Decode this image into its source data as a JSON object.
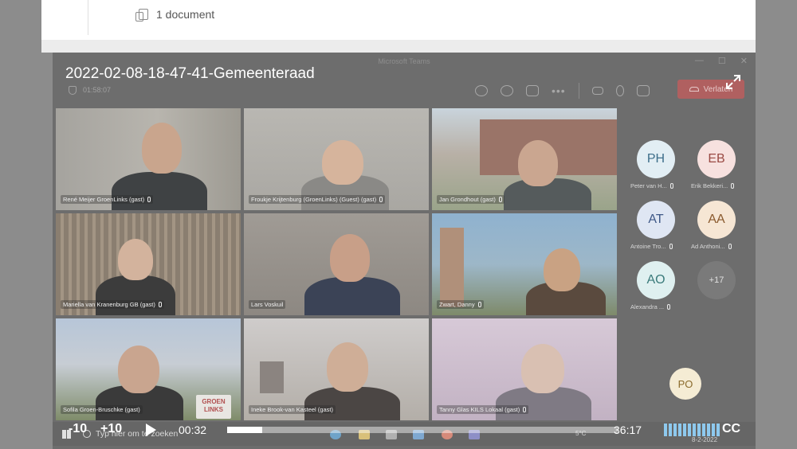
{
  "doc": {
    "count_label": "1 document"
  },
  "window": {
    "app_title": "Microsoft Teams",
    "controls": [
      "—",
      "☐",
      "✕"
    ]
  },
  "meeting": {
    "title": "2022-02-08-18-47-41-Gemeenteraad",
    "elapsed": "01:58:07",
    "leave_label": "Verlaten"
  },
  "tiles": [
    {
      "name": "René Meijer GroenLinks (gast)"
    },
    {
      "name": "Froukje Krijtenburg (GroenLinks) (Guest) (gast)"
    },
    {
      "name": "Jan Grondhout (gast)"
    },
    {
      "name": "Mariella van Kranenburg GB (gast)"
    },
    {
      "name": "Lars Voskuil"
    },
    {
      "name": "Zwart, Danny"
    },
    {
      "name": "Sofila Groen-Bruschke (gast)"
    },
    {
      "name": "Ineke Brook-van Kasteel (gast)"
    },
    {
      "name": "Tanny Glas KILS Lokaal (gast)"
    }
  ],
  "tile_overlay": {
    "groenlinks_logo": "GROEN LINKS"
  },
  "participants": [
    {
      "initials": "PH",
      "label": "Peter van H...",
      "bg": "#e2eef4",
      "fg": "#3d6e8a"
    },
    {
      "initials": "EB",
      "label": "Erik Bekkeri...",
      "bg": "#f7e1df",
      "fg": "#9a4a44"
    },
    {
      "initials": "AT",
      "label": "Antoine Tro...",
      "bg": "#dfe6f3",
      "fg": "#3f5887"
    },
    {
      "initials": "AA",
      "label": "Ad Anthoni...",
      "bg": "#f6e6d4",
      "fg": "#8a5a2e"
    },
    {
      "initials": "AO",
      "label": "Alexandra ...",
      "bg": "#dff0f0",
      "fg": "#3a7a7a"
    }
  ],
  "overflow_count": "+17",
  "self_avatar": {
    "initials": "PO",
    "bg": "#f5ecd4",
    "fg": "#8a6a2a"
  },
  "player": {
    "skip_back": "-10",
    "skip_fwd": "+10",
    "current_time": "00:32",
    "end_time": "36:17",
    "progress_fraction": 0.09,
    "cc": "CC"
  },
  "taskbar": {
    "search_placeholder": "Typ hier om te zoeken",
    "temperature": "5°C",
    "date": "8-2-2022"
  }
}
